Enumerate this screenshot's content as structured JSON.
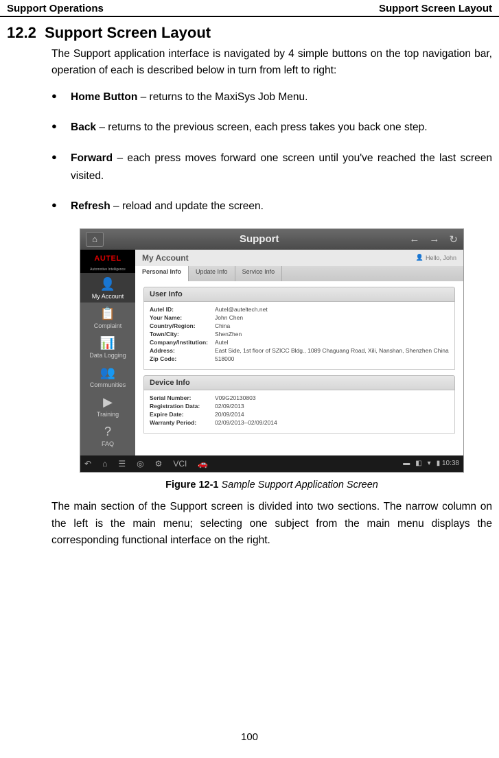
{
  "header": {
    "left": "Support Operations",
    "right": "Support Screen Layout"
  },
  "section": {
    "number": "12.2",
    "title": "Support Screen Layout"
  },
  "intro": "The Support application interface is navigated by 4 simple buttons on the top navigation bar, operation of each is described below in turn from left to right:",
  "bullets": [
    {
      "term": "Home Button",
      "desc": " – returns to the MaxiSys Job Menu."
    },
    {
      "term": "Back",
      "desc": " – returns to the previous screen, each press takes you back one step."
    },
    {
      "term": "Forward",
      "desc": " – each press moves forward one screen until you've reached the last screen visited."
    },
    {
      "term": "Refresh",
      "desc": " – reload and update the screen."
    }
  ],
  "screenshot": {
    "topbar": {
      "home_glyph": "⌂",
      "title": "Support",
      "back_glyph": "←",
      "forward_glyph": "→",
      "refresh_glyph": "↻"
    },
    "logo": {
      "text": "AUTEL",
      "sub": "Automotive Intelligence"
    },
    "sidebar_items": [
      {
        "icon": "👤",
        "label": "My Account",
        "active": true
      },
      {
        "icon": "📋",
        "label": "Complaint"
      },
      {
        "icon": "📊",
        "label": "Data Logging"
      },
      {
        "icon": "👥",
        "label": "Communities"
      },
      {
        "icon": "▶",
        "label": "Training"
      },
      {
        "icon": "?",
        "label": "FAQ"
      }
    ],
    "account_bar": {
      "title": "My Account",
      "hello_icon": "👤",
      "hello": "Hello, John"
    },
    "tabs": [
      {
        "label": "Personal Info",
        "active": true
      },
      {
        "label": "Update Info"
      },
      {
        "label": "Service Info"
      }
    ],
    "user_info": {
      "header": "User Info",
      "rows": [
        {
          "label": "Autel ID:",
          "value": "Autel@auteltech.net"
        },
        {
          "label": "Your Name:",
          "value": "John Chen"
        },
        {
          "label": "Country/Region:",
          "value": "China"
        },
        {
          "label": "Town/City:",
          "value": "ShenZhen"
        },
        {
          "label": "Company/Institution:",
          "value": "Autel"
        },
        {
          "label": "Address:",
          "value": "East Side, 1st floor of SZICC Bldg., 1089 Chaguang Road, Xili, Nanshan, Shenzhen China"
        },
        {
          "label": "Zip Code:",
          "value": "518000"
        }
      ]
    },
    "device_info": {
      "header": "Device Info",
      "rows": [
        {
          "label": "Serial Number:",
          "value": "V09G20130803"
        },
        {
          "label": "Registration Data:",
          "value": "02/09/2013"
        },
        {
          "label": "Expire Date:",
          "value": "20/09/2014"
        },
        {
          "label": "Warranty Period:",
          "value": "02/09/2013--02/09/2014"
        }
      ]
    },
    "bottombar": {
      "icons": [
        "↶",
        "⌂",
        "☰",
        "◎",
        "⚙",
        "VCI",
        "🚗"
      ],
      "right": {
        "batt": "▬",
        "sig": "◧",
        "wifi": "▾",
        "time": "▮ 10:38"
      }
    }
  },
  "figure": {
    "label": "Figure 12-1",
    "desc": " Sample Support Application Screen"
  },
  "after": "The main section of the Support screen is divided into two sections. The narrow column on the left is the main menu; selecting one subject from the main menu displays the corresponding functional interface on the right.",
  "page_number": "100"
}
